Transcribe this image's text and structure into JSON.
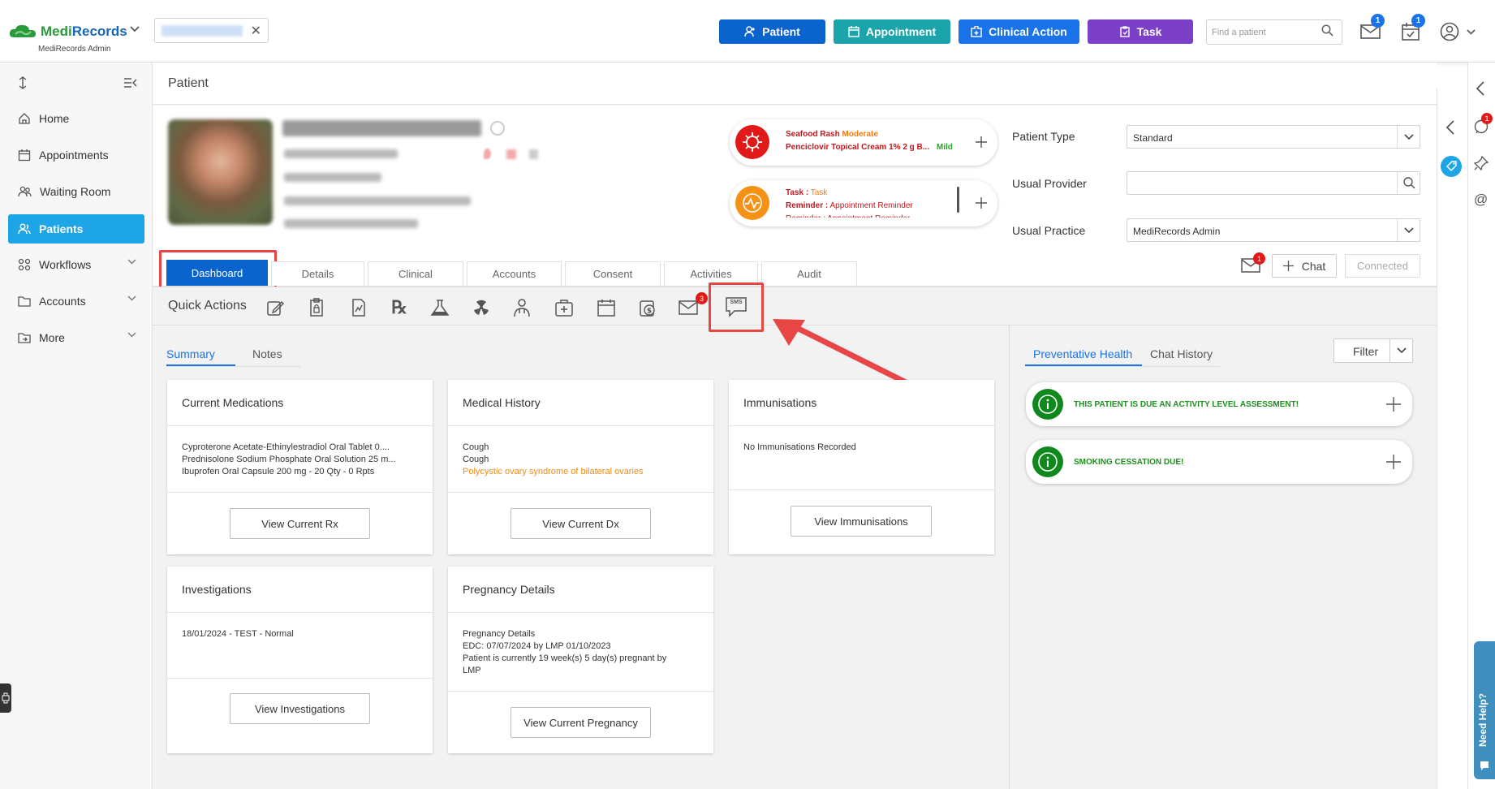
{
  "app": {
    "name_part1": "Medi",
    "name_part2": "Records",
    "subtitle": "MediRecords Admin"
  },
  "header": {
    "buttons": [
      {
        "label": "Patient",
        "color": "#0b63ce"
      },
      {
        "label": "Appointment",
        "color": "#1ba4a9"
      },
      {
        "label": "Clinical Action",
        "color": "#1a73e8"
      },
      {
        "label": "Task",
        "color": "#7c3fc7"
      }
    ],
    "search_placeholder": "Find a patient",
    "mail_badge": "1",
    "tasks_badge": "1"
  },
  "sidebar": {
    "items": [
      {
        "label": "Home"
      },
      {
        "label": "Appointments"
      },
      {
        "label": "Waiting Room"
      },
      {
        "label": "Patients"
      },
      {
        "label": "Workflows"
      },
      {
        "label": "Accounts"
      },
      {
        "label": "More"
      }
    ]
  },
  "page": {
    "title": "Patient"
  },
  "alerts": {
    "allergy_name": "Seafood Rash",
    "allergy_severity": "Moderate",
    "drug_reaction": "Penciclovir Topical Cream 1% 2 g B...",
    "drug_severity": "Mild",
    "task_label": "Task :",
    "task_value": "Task",
    "reminder_label": "Reminder :",
    "reminder_value": "Appointment Reminder",
    "reminder2": "Reminder : Appointment Reminder"
  },
  "patient_fields": [
    {
      "label": "Patient Type",
      "value": "Standard"
    },
    {
      "label": "Usual Provider",
      "value": ""
    },
    {
      "label": "Usual Practice",
      "value": "MediRecords Admin"
    }
  ],
  "chat": {
    "badge": "1",
    "chat_label": "Chat",
    "connected_label": "Connected"
  },
  "tabs": [
    "Dashboard",
    "Details",
    "Clinical",
    "Accounts",
    "Consent",
    "Activities",
    "Audit"
  ],
  "quick_actions": {
    "label": "Quick Actions",
    "mail_badge": "3",
    "sms_label": "SMS"
  },
  "subtabs": [
    "Summary",
    "Notes"
  ],
  "cards": {
    "medications": {
      "title": "Current Medications",
      "lines": [
        "Cyproterone Acetate-Ethinylestradiol Oral Tablet 0....",
        "Prednisolone Sodium Phosphate Oral Solution 25 m...",
        "Ibuprofen Oral Capsule 200 mg - 20 Qty - 0 Rpts"
      ],
      "button": "View Current Rx"
    },
    "history": {
      "title": "Medical History",
      "lines": [
        "Cough",
        "Cough"
      ],
      "highlight": "Polycystic ovary syndrome of bilateral ovaries",
      "button": "View Current Dx"
    },
    "immunisations": {
      "title": "Immunisations",
      "lines": [
        "No Immunisations Recorded"
      ],
      "button": "View Immunisations"
    },
    "investigations": {
      "title": "Investigations",
      "lines": [
        "18/01/2024 - TEST - Normal"
      ],
      "button": "View Investigations"
    },
    "pregnancy": {
      "title": "Pregnancy Details",
      "lines": [
        "Pregnancy Details",
        "EDC: 07/07/2024 by LMP 01/10/2023",
        "Patient is currently 19 week(s) 5 day(s) pregnant by",
        "LMP"
      ],
      "button": "View Current Pregnancy"
    }
  },
  "right_panel": {
    "tabs": [
      "Preventative Health",
      "Chat History"
    ],
    "filter_label": "Filter",
    "items": [
      "THIS PATIENT IS DUE AN ACTIVITY LEVEL ASSESSMENT!",
      "SMOKING CESSATION DUE!"
    ]
  },
  "rail": {
    "badge": "1",
    "help_label": "Need Help?"
  }
}
